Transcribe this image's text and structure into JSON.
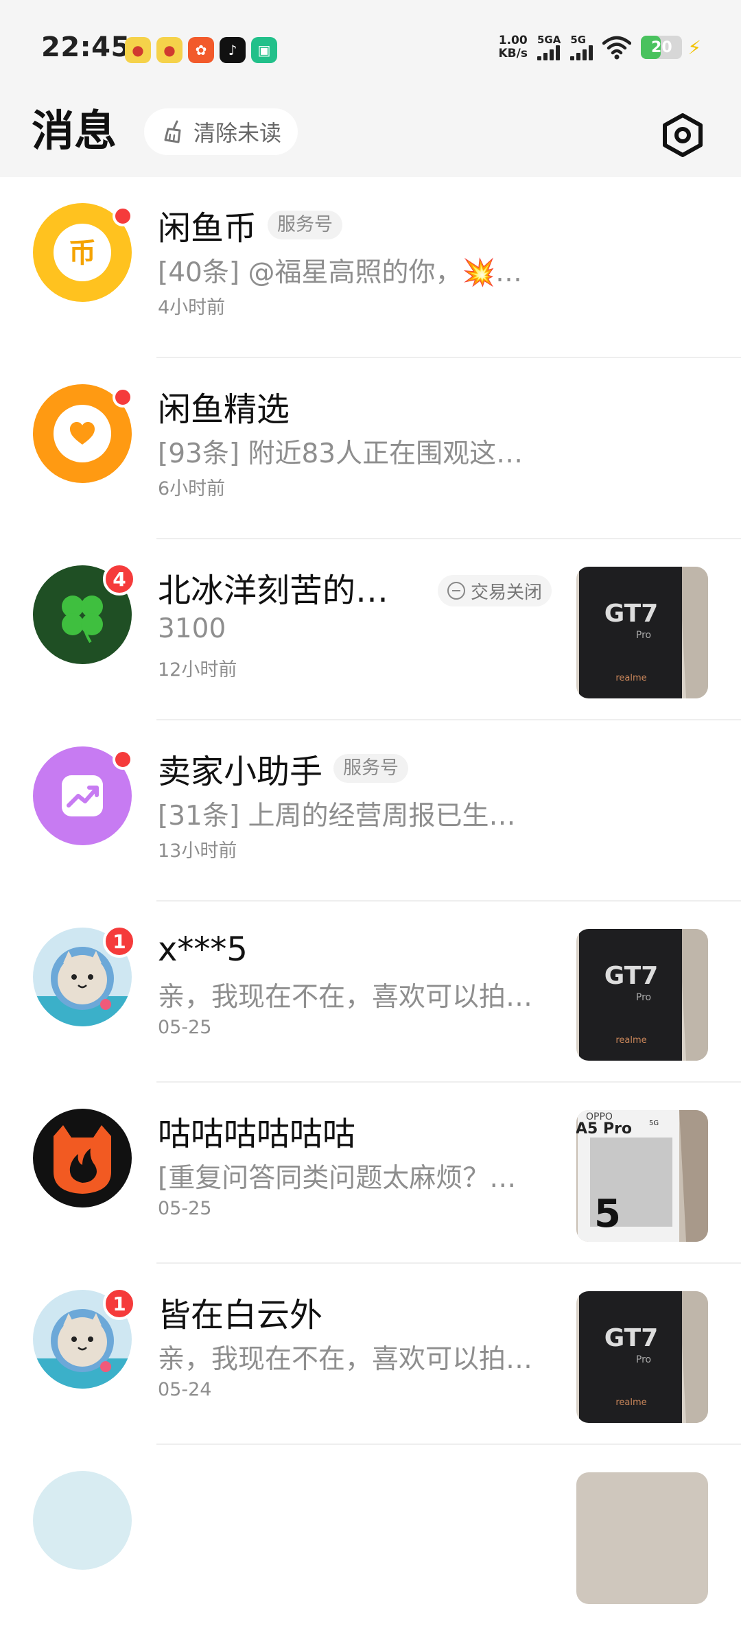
{
  "status_bar": {
    "time": "22:45",
    "net_speed_value": "1.00",
    "net_speed_unit": "KB/s",
    "signal1_label": "5GA",
    "signal2_label": "5G",
    "battery": "20",
    "app_icons": [
      "weibo-icon",
      "weibo-icon",
      "jd-icon",
      "tiktok-icon",
      "mi-home-icon"
    ]
  },
  "header": {
    "title": "消息",
    "clear_unread_label": "清除未读"
  },
  "conversations": [
    {
      "name": "闲鱼币",
      "tag": "服务号",
      "preview": "[40条] @福星高照的你，💥…",
      "time": "4小时前",
      "unread": "dot"
    },
    {
      "name": "闲鱼精选",
      "preview": "[93条] 附近83人正在围观这…",
      "time": "6小时前",
      "unread": "dot"
    },
    {
      "name": "北冰洋刻苦的…",
      "status": "交易关闭",
      "preview": "3100",
      "time": "12小时前",
      "badge": "4",
      "thumb_text": "GT7",
      "thumb_sub": "Pro",
      "thumb_brand": "realme"
    },
    {
      "name": "卖家小助手",
      "tag": "服务号",
      "preview": "[31条] 上周的经营周报已生…",
      "time": "13小时前",
      "unread": "dot"
    },
    {
      "name": "x***5",
      "preview": "亲，我现在不在，喜欢可以拍…",
      "time": "05-25",
      "badge": "1",
      "thumb_text": "GT7",
      "thumb_sub": "Pro",
      "thumb_brand": "realme"
    },
    {
      "name": "咕咕咕咕咕咕",
      "preview": "[重复问答同类问题太麻烦？…",
      "time": "05-25",
      "thumb_text": "A5 Pro",
      "thumb_sub": "5G",
      "thumb_big": "5",
      "thumb_top": "OPPO"
    },
    {
      "name": "皆在白云外",
      "preview": "亲，我现在不在，喜欢可以拍…",
      "time": "05-24",
      "badge": "1",
      "thumb_text": "GT7",
      "thumb_sub": "Pro",
      "thumb_brand": "realme"
    }
  ],
  "colors": {
    "accent_red": "#f53b3b",
    "coin_yellow": "#ffc21f",
    "select_orange": "#ff9a12",
    "assistant_purple": "#c77bf2",
    "clover_green": "#1f4f24"
  }
}
